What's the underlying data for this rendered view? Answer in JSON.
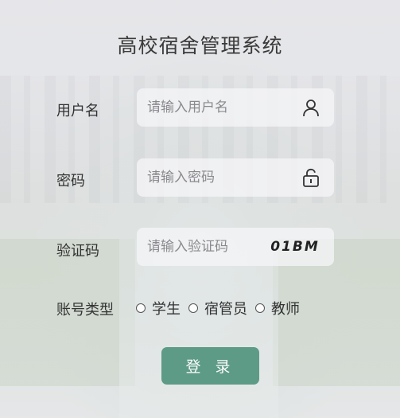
{
  "title": "高校宿舍管理系统",
  "form": {
    "username": {
      "label": "用户名",
      "placeholder": "请输入用户名",
      "icon": "user-icon"
    },
    "password": {
      "label": "密码",
      "placeholder": "请输入密码",
      "icon": "unlock-icon"
    },
    "captcha": {
      "label": "验证码",
      "placeholder": "请输入验证码",
      "code": "01BM"
    },
    "account_type": {
      "label": "账号类型",
      "options": [
        "学生",
        "宿管员",
        "教师"
      ]
    },
    "submit_label": "登 录"
  },
  "colors": {
    "button": "#4b9179",
    "text": "#333333"
  }
}
